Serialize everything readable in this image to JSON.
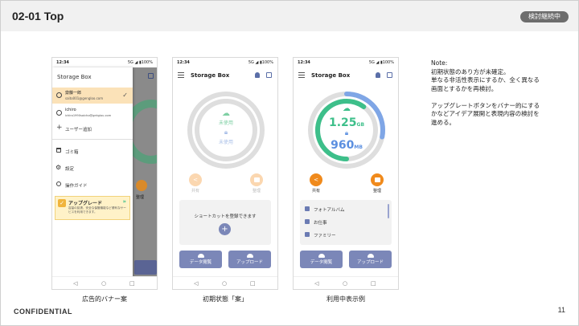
{
  "slide": {
    "title": "02-01 Top",
    "status_badge": "検討継続中",
    "footer_left": "CONFIDENTIAL",
    "page_number": "11"
  },
  "note": {
    "heading": "Note:",
    "para1": "初期状態のあり方が未確定。\n単なる非活性表示にするか、全く異なる\n画面とするかを再検討。",
    "para2": "アップグレートボタンをバナー的にする\nかなどアイデア展開と表現内容の検討を\n進める。"
  },
  "common": {
    "time": "12:34",
    "signal": "5G ◢ ▮100%",
    "app_title": "Storage Box",
    "nav_back": "◁",
    "nav_home": "○",
    "nav_recent": "□",
    "share_label": "共有",
    "organize_label": "整理",
    "data_view_label": "データ閲覧",
    "upload_label": "アップロード"
  },
  "screen1": {
    "caption": "広告的バナー案",
    "app_title": "Storage Box",
    "account1_name": "齋藤一郎",
    "account1_email": "saito001@gengloo.com",
    "account2_name": "ichiro",
    "account2_email": "ichiro1990saicho@gekgiou.com",
    "add_user": "ユーザー追加",
    "menu_trash": "ゴミ箱",
    "menu_settings": "設定",
    "menu_guide": "操作ガイド",
    "upgrade_title": "アップグレード",
    "upgrade_desc": "容量の拡張、安全な保管機能など便利なサービスを利用できます。",
    "behind_label": "整理"
  },
  "screen2": {
    "caption": "初期状態「案」",
    "ring_top": "未使用",
    "ring_bottom": "未使用",
    "shortcut_text": "ショートカットを登録できます"
  },
  "screen3": {
    "caption": "利用中表示例",
    "cloud_value": "1.25",
    "cloud_unit": "GB",
    "local_value": "960",
    "local_unit": "MB",
    "shortcuts": [
      "フォトアルバム",
      "お仕事",
      "ファミリー"
    ]
  },
  "usage": {
    "cloud_fraction": 0.28,
    "local_fraction": 0.6,
    "cloud_color": "#7fa6e6",
    "local_color": "#3dbf8a"
  }
}
